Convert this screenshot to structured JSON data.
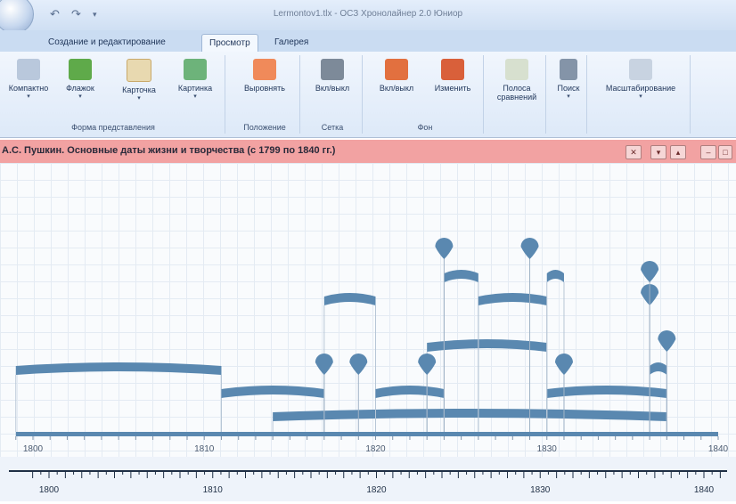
{
  "window": {
    "title": "Lermontov1.tlx - ОСЗ Хронолайнер 2.0 Юниор"
  },
  "tabs": [
    {
      "label": "Создание и редактирование"
    },
    {
      "label": "Просмотр"
    },
    {
      "label": "Галерея"
    }
  ],
  "ribbon": {
    "groups": [
      {
        "caption": "Форма представления",
        "buttons": [
          {
            "label": "Компактно"
          },
          {
            "label": "Флажок"
          },
          {
            "label": "Карточка"
          },
          {
            "label": "Картинка"
          }
        ]
      },
      {
        "caption": "Положение",
        "buttons": [
          {
            "label": "Выровнять"
          }
        ]
      },
      {
        "caption": "Сетка",
        "buttons": [
          {
            "label": "Вкл/выкл"
          }
        ]
      },
      {
        "caption": "Фон",
        "buttons": [
          {
            "label": "Вкл/выкл"
          },
          {
            "label": "Изменить"
          }
        ]
      },
      {
        "caption": "",
        "buttons": [
          {
            "label": "Полоса сравнений"
          }
        ]
      },
      {
        "caption": "",
        "buttons": [
          {
            "label": "Поиск"
          }
        ]
      },
      {
        "caption": "",
        "buttons": [
          {
            "label": "Масштабирование"
          }
        ]
      }
    ]
  },
  "chart_panel": {
    "title": "А.С. Пушкин. Основные даты жизни и творчества (с 1799 по 1840 гг.)"
  },
  "chart_data": {
    "type": "timeline",
    "x_range": [
      1799,
      1840
    ],
    "tick_labels": [
      "1800",
      "1810",
      "1820",
      "1830",
      "1840"
    ],
    "periods": [
      {
        "start": 1799,
        "end": 1811,
        "level": 3
      },
      {
        "start": 1811,
        "end": 1817,
        "level": 2
      },
      {
        "start": 1814,
        "end": 1837,
        "level": 1
      },
      {
        "start": 1817,
        "end": 1820,
        "level": 6
      },
      {
        "start": 1820,
        "end": 1824,
        "level": 2
      },
      {
        "start": 1823,
        "end": 1830,
        "level": 4
      },
      {
        "start": 1824,
        "end": 1826,
        "level": 7
      },
      {
        "start": 1826,
        "end": 1830,
        "level": 6
      },
      {
        "start": 1830,
        "end": 1837,
        "level": 2
      },
      {
        "start": 1830,
        "end": 1831,
        "level": 7
      },
      {
        "start": 1836,
        "end": 1837,
        "level": 3
      }
    ],
    "events": [
      {
        "year": 1817,
        "level": 3
      },
      {
        "year": 1819,
        "level": 3
      },
      {
        "year": 1823,
        "level": 3
      },
      {
        "year": 1824,
        "level": 8
      },
      {
        "year": 1829,
        "level": 8
      },
      {
        "year": 1831,
        "level": 3
      },
      {
        "year": 1836,
        "level": 6
      },
      {
        "year": 1836,
        "level": 7
      },
      {
        "year": 1837,
        "level": 4
      }
    ]
  },
  "bottom_scale": {
    "tick_labels": [
      "1800",
      "1810",
      "1820",
      "1830",
      "1840"
    ]
  },
  "colors": {
    "accent": "#5a88b0",
    "header": "#f2a2a2"
  }
}
